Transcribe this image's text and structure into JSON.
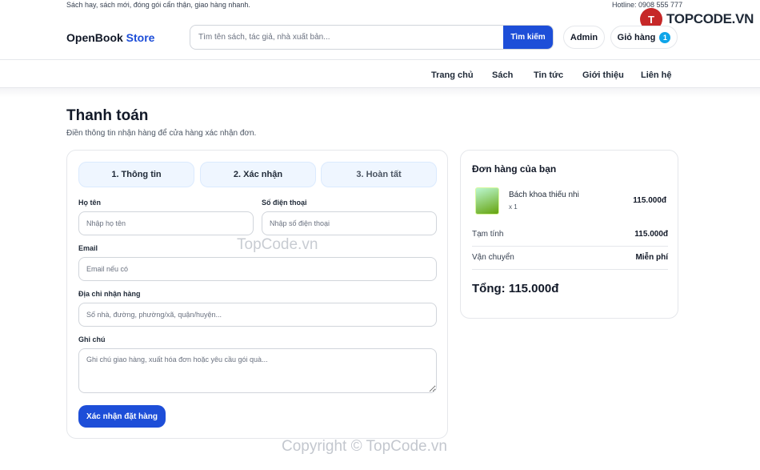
{
  "topbar": {
    "tagline": "Sách hay, sách mới, đóng gói cẩn thận, giao hàng nhanh.",
    "hotline": "Hotline: 0908 555 777"
  },
  "brandmark": {
    "logo_letter": "T",
    "text": "TOPCODE.VN"
  },
  "header": {
    "brand_main": "OpenBook",
    "brand_accent": "Store",
    "search_placeholder": "Tìm tên sách, tác giả, nhà xuất bản...",
    "search_button": "Tìm kiếm",
    "admin_label": "Admin",
    "cart_label": "Giỏ hàng",
    "cart_count": "1"
  },
  "nav": [
    {
      "label": "Trang chủ"
    },
    {
      "label": "Sách"
    },
    {
      "label": "Tin tức"
    },
    {
      "label": "Giới thiệu"
    },
    {
      "label": "Liên hệ"
    }
  ],
  "page": {
    "title": "Thanh toán",
    "subtitle": "Điền thông tin nhận hàng để cửa hàng xác nhận đơn."
  },
  "steps": [
    "1. Thông tin",
    "2. Xác nhận",
    "3. Hoàn tất"
  ],
  "form": {
    "name_label": "Họ tên",
    "name_placeholder": "Nhập họ tên",
    "phone_label": "Số điện thoại",
    "phone_placeholder": "Nhập số điện thoại",
    "email_label": "Email",
    "email_placeholder": "Email nếu có",
    "address_label": "Địa chỉ nhận hàng",
    "address_placeholder": "Số nhà, đường, phường/xã, quận/huyện...",
    "note_label": "Ghi chú",
    "note_placeholder": "Ghi chú giao hàng, xuất hóa đơn hoặc yêu cầu gói quà...",
    "submit_label": "Xác nhận đặt hàng"
  },
  "summary": {
    "title": "Đơn hàng của bạn",
    "item": {
      "name": "Bách khoa thiếu nhi",
      "qty": "x 1",
      "price": "115.000đ"
    },
    "subtotal_label": "Tạm tính",
    "subtotal_value": "115.000đ",
    "shipping_label": "Vận chuyển",
    "shipping_value": "Miễn phí",
    "total": "Tổng: 115.000đ"
  },
  "watermarks": {
    "center": "TopCode.vn",
    "footer": "Copyright © TopCode.vn"
  },
  "colors": {
    "primary": "#1d4ed8",
    "badge": "#0ea5e9",
    "step_bg": "#eff6ff",
    "brand_logo": "#c62828"
  }
}
